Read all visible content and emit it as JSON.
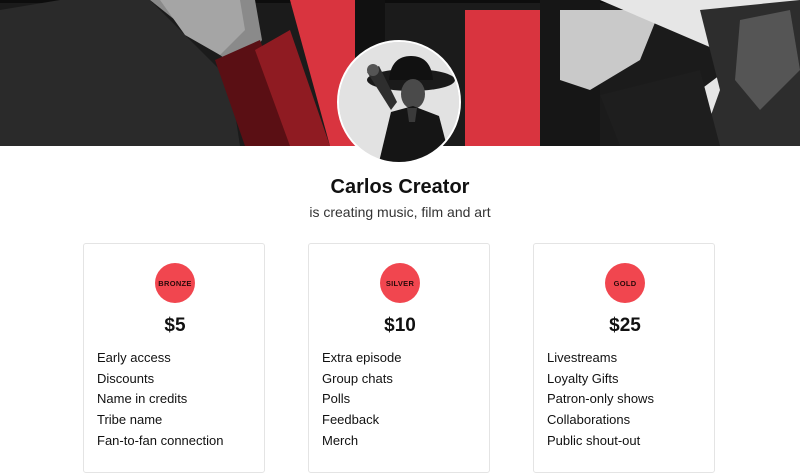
{
  "creator": {
    "name": "Carlos Creator",
    "tagline": "is creating music, film and art"
  },
  "colors": {
    "accent": "#f1464f",
    "banner_red": "#d9343f"
  },
  "tiers": [
    {
      "badge": "BRONZE",
      "price": "$5",
      "perks": [
        "Early access",
        "Discounts",
        "Name in credits",
        "Tribe name",
        "Fan-to-fan connection"
      ]
    },
    {
      "badge": "SILVER",
      "price": "$10",
      "perks": [
        "Extra episode",
        "Group chats",
        "Polls",
        "Feedback",
        "Merch"
      ]
    },
    {
      "badge": "GOLD",
      "price": "$25",
      "perks": [
        "Livestreams",
        "Loyalty Gifts",
        "Patron-only shows",
        "Collaborations",
        "Public shout-out"
      ]
    }
  ]
}
